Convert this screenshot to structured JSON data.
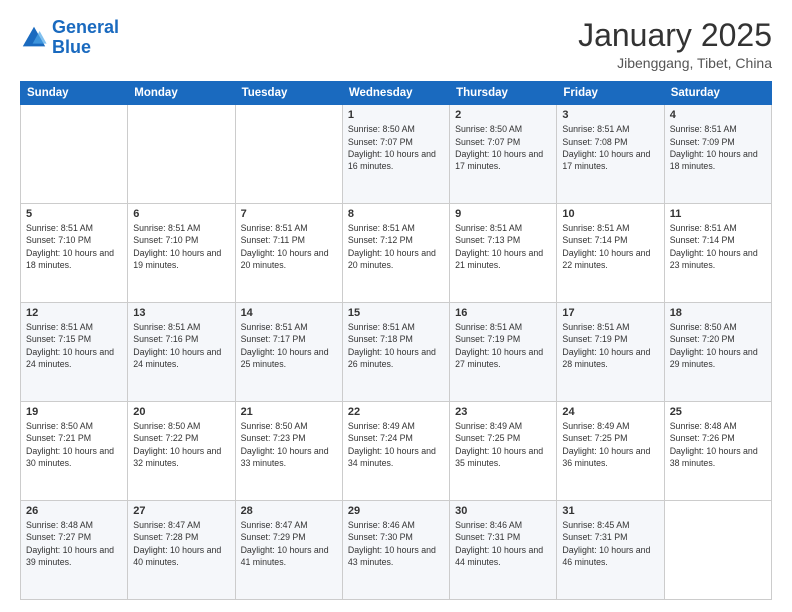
{
  "logo": {
    "text_general": "General",
    "text_blue": "Blue"
  },
  "header": {
    "title": "January 2025",
    "subtitle": "Jibenggang, Tibet, China"
  },
  "weekdays": [
    "Sunday",
    "Monday",
    "Tuesday",
    "Wednesday",
    "Thursday",
    "Friday",
    "Saturday"
  ],
  "weeks": [
    [
      {
        "day": "",
        "info": ""
      },
      {
        "day": "",
        "info": ""
      },
      {
        "day": "",
        "info": ""
      },
      {
        "day": "1",
        "info": "Sunrise: 8:50 AM\nSunset: 7:07 PM\nDaylight: 10 hours and 16 minutes."
      },
      {
        "day": "2",
        "info": "Sunrise: 8:50 AM\nSunset: 7:07 PM\nDaylight: 10 hours and 17 minutes."
      },
      {
        "day": "3",
        "info": "Sunrise: 8:51 AM\nSunset: 7:08 PM\nDaylight: 10 hours and 17 minutes."
      },
      {
        "day": "4",
        "info": "Sunrise: 8:51 AM\nSunset: 7:09 PM\nDaylight: 10 hours and 18 minutes."
      }
    ],
    [
      {
        "day": "5",
        "info": "Sunrise: 8:51 AM\nSunset: 7:10 PM\nDaylight: 10 hours and 18 minutes."
      },
      {
        "day": "6",
        "info": "Sunrise: 8:51 AM\nSunset: 7:10 PM\nDaylight: 10 hours and 19 minutes."
      },
      {
        "day": "7",
        "info": "Sunrise: 8:51 AM\nSunset: 7:11 PM\nDaylight: 10 hours and 20 minutes."
      },
      {
        "day": "8",
        "info": "Sunrise: 8:51 AM\nSunset: 7:12 PM\nDaylight: 10 hours and 20 minutes."
      },
      {
        "day": "9",
        "info": "Sunrise: 8:51 AM\nSunset: 7:13 PM\nDaylight: 10 hours and 21 minutes."
      },
      {
        "day": "10",
        "info": "Sunrise: 8:51 AM\nSunset: 7:14 PM\nDaylight: 10 hours and 22 minutes."
      },
      {
        "day": "11",
        "info": "Sunrise: 8:51 AM\nSunset: 7:14 PM\nDaylight: 10 hours and 23 minutes."
      }
    ],
    [
      {
        "day": "12",
        "info": "Sunrise: 8:51 AM\nSunset: 7:15 PM\nDaylight: 10 hours and 24 minutes."
      },
      {
        "day": "13",
        "info": "Sunrise: 8:51 AM\nSunset: 7:16 PM\nDaylight: 10 hours and 24 minutes."
      },
      {
        "day": "14",
        "info": "Sunrise: 8:51 AM\nSunset: 7:17 PM\nDaylight: 10 hours and 25 minutes."
      },
      {
        "day": "15",
        "info": "Sunrise: 8:51 AM\nSunset: 7:18 PM\nDaylight: 10 hours and 26 minutes."
      },
      {
        "day": "16",
        "info": "Sunrise: 8:51 AM\nSunset: 7:19 PM\nDaylight: 10 hours and 27 minutes."
      },
      {
        "day": "17",
        "info": "Sunrise: 8:51 AM\nSunset: 7:19 PM\nDaylight: 10 hours and 28 minutes."
      },
      {
        "day": "18",
        "info": "Sunrise: 8:50 AM\nSunset: 7:20 PM\nDaylight: 10 hours and 29 minutes."
      }
    ],
    [
      {
        "day": "19",
        "info": "Sunrise: 8:50 AM\nSunset: 7:21 PM\nDaylight: 10 hours and 30 minutes."
      },
      {
        "day": "20",
        "info": "Sunrise: 8:50 AM\nSunset: 7:22 PM\nDaylight: 10 hours and 32 minutes."
      },
      {
        "day": "21",
        "info": "Sunrise: 8:50 AM\nSunset: 7:23 PM\nDaylight: 10 hours and 33 minutes."
      },
      {
        "day": "22",
        "info": "Sunrise: 8:49 AM\nSunset: 7:24 PM\nDaylight: 10 hours and 34 minutes."
      },
      {
        "day": "23",
        "info": "Sunrise: 8:49 AM\nSunset: 7:25 PM\nDaylight: 10 hours and 35 minutes."
      },
      {
        "day": "24",
        "info": "Sunrise: 8:49 AM\nSunset: 7:25 PM\nDaylight: 10 hours and 36 minutes."
      },
      {
        "day": "25",
        "info": "Sunrise: 8:48 AM\nSunset: 7:26 PM\nDaylight: 10 hours and 38 minutes."
      }
    ],
    [
      {
        "day": "26",
        "info": "Sunrise: 8:48 AM\nSunset: 7:27 PM\nDaylight: 10 hours and 39 minutes."
      },
      {
        "day": "27",
        "info": "Sunrise: 8:47 AM\nSunset: 7:28 PM\nDaylight: 10 hours and 40 minutes."
      },
      {
        "day": "28",
        "info": "Sunrise: 8:47 AM\nSunset: 7:29 PM\nDaylight: 10 hours and 41 minutes."
      },
      {
        "day": "29",
        "info": "Sunrise: 8:46 AM\nSunset: 7:30 PM\nDaylight: 10 hours and 43 minutes."
      },
      {
        "day": "30",
        "info": "Sunrise: 8:46 AM\nSunset: 7:31 PM\nDaylight: 10 hours and 44 minutes."
      },
      {
        "day": "31",
        "info": "Sunrise: 8:45 AM\nSunset: 7:31 PM\nDaylight: 10 hours and 46 minutes."
      },
      {
        "day": "",
        "info": ""
      }
    ]
  ]
}
